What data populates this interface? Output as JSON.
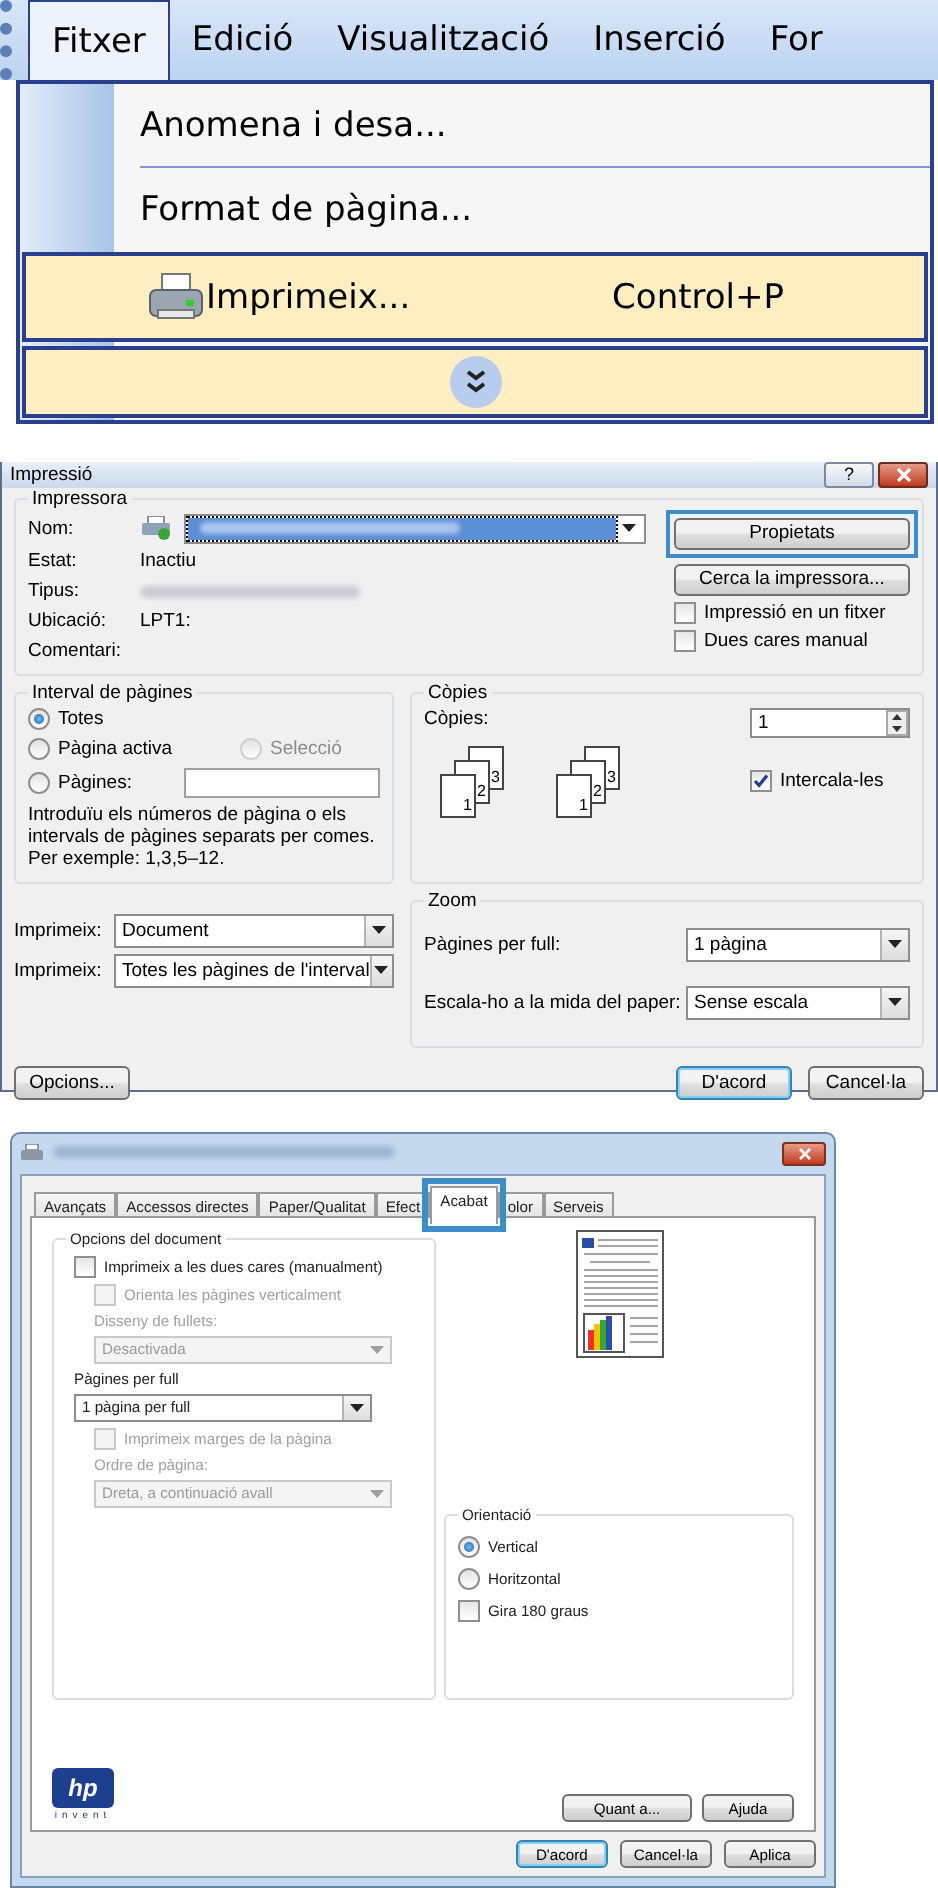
{
  "menu": {
    "bar": [
      {
        "label": "Fitxer",
        "selected": true
      },
      {
        "label": "Edició",
        "selected": false
      },
      {
        "label": "Visualització",
        "selected": false
      },
      {
        "label": "Inserció",
        "selected": false
      },
      {
        "label": "For",
        "selected": false
      }
    ],
    "items": [
      {
        "kind": "command",
        "label": "Anomena i desa...",
        "highlighted": false
      },
      {
        "kind": "command",
        "label": "Format de pàgina...",
        "highlighted": false
      },
      {
        "kind": "command",
        "label": "Imprimeix...",
        "shortcut": "Control+P",
        "highlighted": true
      },
      {
        "kind": "expand",
        "highlighted": true
      }
    ]
  },
  "print_dialog": {
    "title": "Impressió",
    "help_button": "?",
    "printer": {
      "legend": "Impressora",
      "name_label": "Nom:",
      "status_label": "Estat:",
      "status": "Inactiu",
      "type_label": "Tipus:",
      "location_label": "Ubicació:",
      "location": "LPT1:",
      "comment_label": "Comentari:",
      "properties_button": {
        "label": "Propietats",
        "callout": true
      },
      "find_button": "Cerca la impressora...",
      "options": [
        {
          "label": "Impressió en un fitxer",
          "checked": false
        },
        {
          "label": "Dues cares manual",
          "checked": false
        }
      ]
    },
    "page_range": {
      "legend": "Interval de pàgines",
      "options": [
        {
          "label": "Totes",
          "selected": true,
          "disabled": false
        },
        {
          "label": "Pàgina activa",
          "selected": false,
          "disabled": false
        },
        {
          "label": "Selecció",
          "selected": false,
          "disabled": true
        },
        {
          "label": "Pàgines:",
          "selected": false,
          "disabled": false
        }
      ],
      "hint": "Introduïu els números de pàgina o els intervals de pàgines separats per comes. Per exemple: 1,3,5–12."
    },
    "copies": {
      "legend": "Còpies",
      "label": "Còpies:",
      "value": "1",
      "page_stacks": [
        [
          "3",
          "2",
          "1"
        ],
        [
          "3",
          "2",
          "1"
        ]
      ],
      "collate": {
        "label": "Intercala-les",
        "checked": true
      }
    },
    "print_what": [
      {
        "label": "Imprimeix:",
        "value": "Document"
      },
      {
        "label": "Imprimeix:",
        "value": "Totes les pàgines de l'interval"
      }
    ],
    "zoom": {
      "legend": "Zoom",
      "rows": [
        {
          "label": "Pàgines per full:",
          "value": "1 pàgina"
        },
        {
          "label": "Escala-ho a la mida del paper:",
          "value": "Sense escala"
        }
      ]
    },
    "options_button": "Opcions...",
    "buttons": [
      {
        "label": "D'acord",
        "default": true
      },
      {
        "label": "Cancel·la",
        "default": false
      }
    ]
  },
  "preferences_dialog": {
    "tabs": [
      {
        "label": "Avançats",
        "selected": false,
        "callout": false
      },
      {
        "label": "Accessos directes",
        "selected": false,
        "callout": false
      },
      {
        "label": "Paper/Qualitat",
        "selected": false,
        "callout": false
      },
      {
        "label": "Efect",
        "selected": false,
        "callout": false
      },
      {
        "label": "Acabat",
        "selected": true,
        "callout": true
      },
      {
        "label": "olor",
        "selected": false,
        "callout": false
      },
      {
        "label": "Serveis",
        "selected": false,
        "callout": false
      }
    ],
    "document_options": {
      "legend": "Opcions del document",
      "items": [
        {
          "kind": "checkbox",
          "label": "Imprimeix a les dues cares (manualment)",
          "checked": false,
          "disabled": false,
          "children": [
            {
              "kind": "checkbox",
              "label": "Orienta les pàgines verticalment",
              "checked": false,
              "disabled": true
            },
            {
              "kind": "label",
              "label": "Disseny de fullets:",
              "disabled": true
            },
            {
              "kind": "select",
              "value": "Desactivada",
              "disabled": true
            }
          ]
        },
        {
          "kind": "label",
          "label": "Pàgines per full",
          "disabled": false
        },
        {
          "kind": "select",
          "value": "1 pàgina per full",
          "disabled": false,
          "children": [
            {
              "kind": "checkbox",
              "label": "Imprimeix marges de la pàgina",
              "checked": false,
              "disabled": true
            },
            {
              "kind": "label",
              "label": "Ordre de pàgina:",
              "disabled": true
            },
            {
              "kind": "select",
              "value": "Dreta, a continuació avall",
              "disabled": true
            }
          ]
        }
      ]
    },
    "orientation": {
      "legend": "Orientació",
      "items": [
        {
          "kind": "radio",
          "label": "Vertical",
          "selected": true
        },
        {
          "kind": "radio",
          "label": "Horitzontal",
          "selected": false
        },
        {
          "kind": "checkbox",
          "label": "Gira 180 graus",
          "checked": false
        }
      ]
    },
    "logo": {
      "mark": "hp",
      "tagline": "invent"
    },
    "inner_buttons": [
      "Quant a...",
      "Ajuda"
    ],
    "buttons": [
      {
        "label": "D'acord",
        "default": true
      },
      {
        "label": "Cancel·la",
        "default": false
      },
      {
        "label": "Aplica",
        "default": false
      }
    ]
  }
}
